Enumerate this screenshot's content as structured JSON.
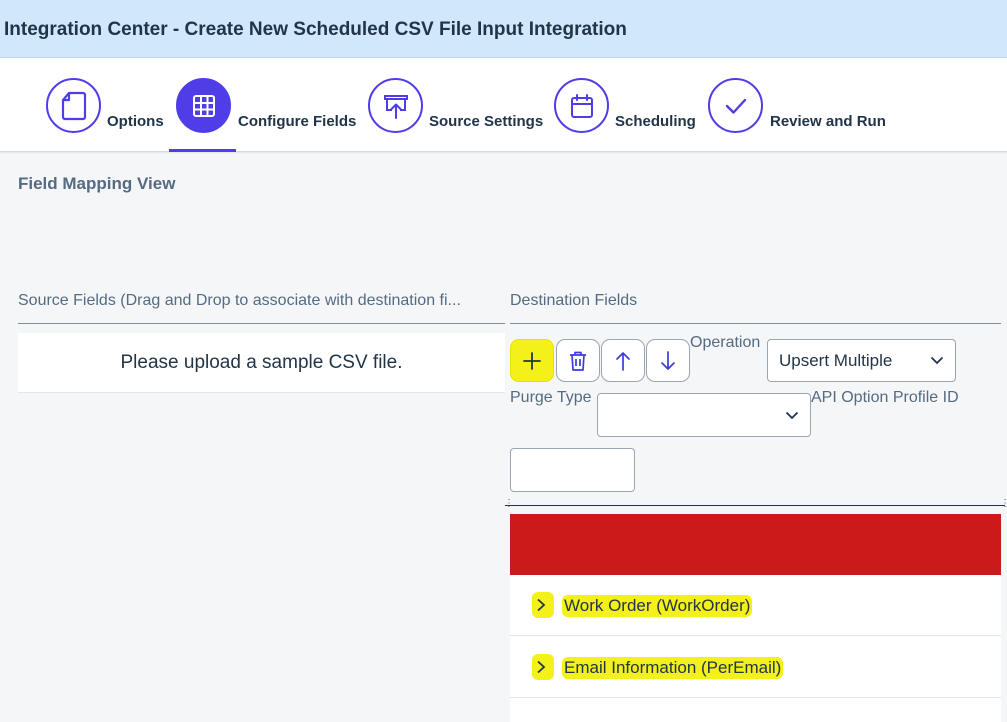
{
  "header": {
    "title": "Integration Center - Create New Scheduled CSV File Input Integration"
  },
  "wizard": {
    "steps": [
      {
        "label": "Options",
        "icon": "document-icon",
        "active": false
      },
      {
        "label": "Configure Fields",
        "icon": "grid-icon",
        "active": true
      },
      {
        "label": "Source Settings",
        "icon": "upload-icon",
        "active": false
      },
      {
        "label": "Scheduling",
        "icon": "calendar-icon",
        "active": false
      },
      {
        "label": "Review and Run",
        "icon": "checkmark-icon",
        "active": false
      }
    ]
  },
  "main": {
    "section_title": "Field Mapping View",
    "source": {
      "header": "Source Fields (Drag and Drop to associate with destination fi...",
      "empty_message": "Please upload a sample CSV file."
    },
    "destination": {
      "header": "Destination Fields",
      "toolbar": [
        {
          "name": "add",
          "icon": "plus-icon"
        },
        {
          "name": "delete",
          "icon": "trash-icon"
        },
        {
          "name": "move-up",
          "icon": "arrow-up-icon"
        },
        {
          "name": "move-down",
          "icon": "arrow-down-icon"
        }
      ],
      "operation_label": "Operation",
      "operation_value": "Upsert Multiple",
      "purge_type_label": "Purge Type",
      "purge_type_value": "",
      "api_option_label": "API Option Profile ID",
      "api_option_value": "",
      "tree": [
        {
          "label": "Work Order (WorkOrder)",
          "highlighted": true
        },
        {
          "label": "Email Information (PerEmail)",
          "highlighted": true
        }
      ]
    }
  },
  "colors": {
    "accent": "#4f3de8",
    "header_bg": "#d1e8fa",
    "error_banner": "#cc1919",
    "highlight": "#f4f01a"
  }
}
